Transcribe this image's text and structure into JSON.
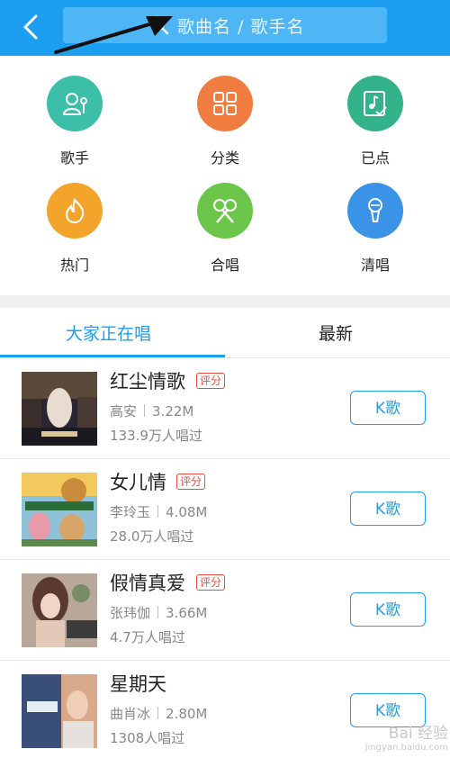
{
  "header": {
    "back_icon": "chevron-left-icon",
    "search_icon": "search-icon",
    "search_placeholder": "歌曲名 / 歌手名",
    "colors": {
      "bar": "#1c9ff1",
      "search": "#4fb6f5"
    }
  },
  "categories": [
    {
      "label": "歌手",
      "icon": "singer-icon",
      "color": "#3bbfa9"
    },
    {
      "label": "分类",
      "icon": "grid-icon",
      "color": "#f07d3f"
    },
    {
      "label": "已点",
      "icon": "music-note-check-icon",
      "color": "#34b38a"
    },
    {
      "label": "热门",
      "icon": "flame-icon",
      "color": "#f3a52b"
    },
    {
      "label": "合唱",
      "icon": "duet-mic-icon",
      "color": "#6cc64a"
    },
    {
      "label": "清唱",
      "icon": "microphone-icon",
      "color": "#3a93e6"
    }
  ],
  "tabs": {
    "active": "大家正在唱",
    "other": "最新"
  },
  "songs": [
    {
      "title": "红尘情歌",
      "badge": "评分",
      "singer": "高安",
      "size": "3.22M",
      "plays": "133.9万人唱过",
      "button": "K歌"
    },
    {
      "title": "女儿情",
      "badge": "评分",
      "singer": "李玲玉",
      "size": "4.08M",
      "plays": "28.0万人唱过",
      "button": "K歌"
    },
    {
      "title": "假情真爱",
      "badge": "评分",
      "singer": "张玮伽",
      "size": "3.66M",
      "plays": "4.7万人唱过",
      "button": "K歌"
    },
    {
      "title": "星期天",
      "badge": "",
      "singer": "曲肖冰",
      "size": "2.80M",
      "plays": "1308人唱过",
      "button": "K歌"
    }
  ],
  "watermark": {
    "line1": "Bai 经验",
    "line2": "jingyan.baidu.com"
  }
}
